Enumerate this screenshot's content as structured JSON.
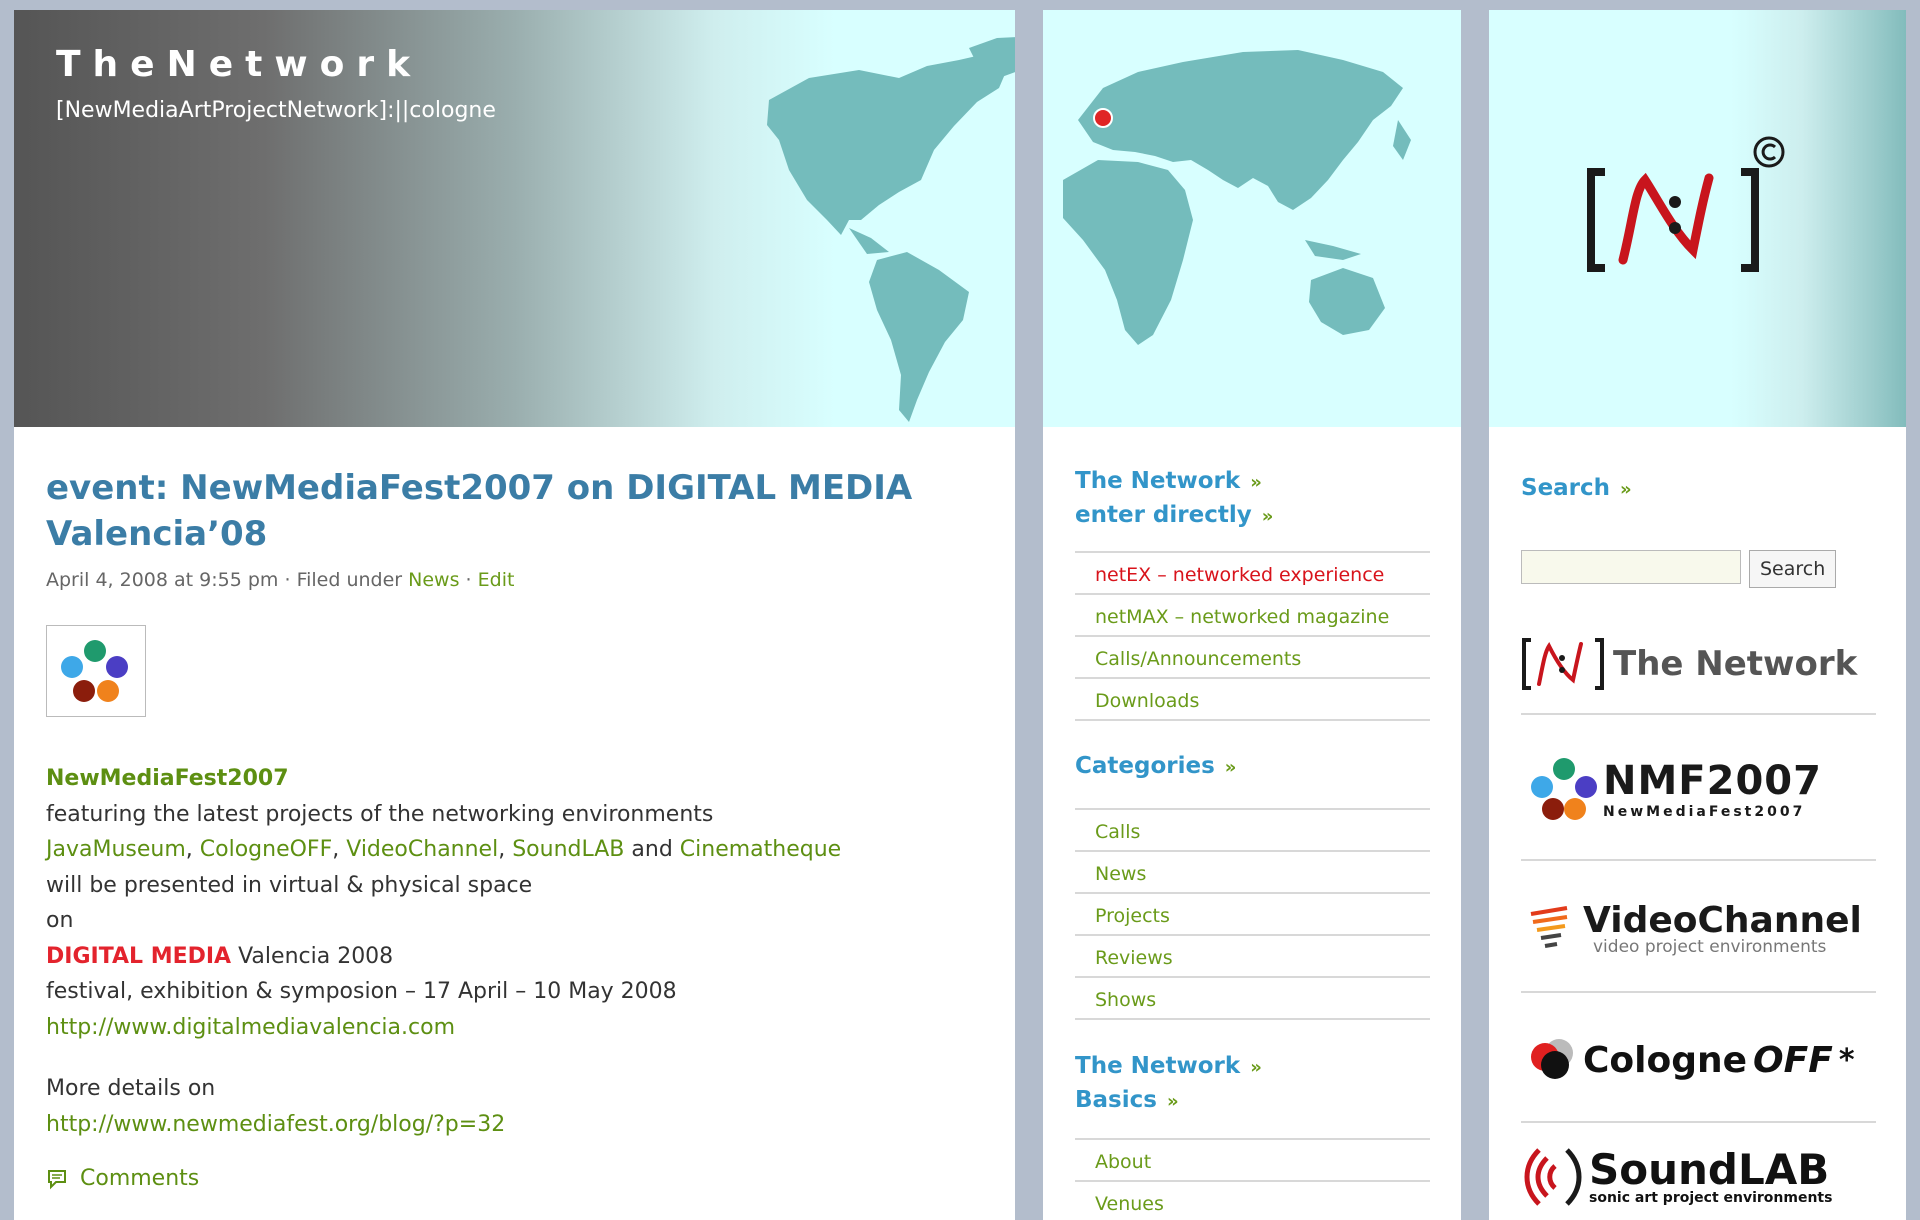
{
  "site": {
    "title": "TheNetwork",
    "tagline": "[NewMediaArtProjectNetwork]:||cologne"
  },
  "post": {
    "title": "event: NewMediaFest2007 on DIGITAL MEDIA Valencia’08",
    "date": "April 4, 2008 at 9:55 pm",
    "filed_under": "· Filed under",
    "category": "News",
    "sep": "·",
    "edit": "Edit",
    "fest_name": "NewMediaFest2007",
    "line1": "featuring the latest projects of the networking environments",
    "env_links": [
      "JavaMuseum",
      "CologneOFF",
      "VideoChannel",
      "SoundLAB",
      "Cinematheque"
    ],
    "and": "and",
    "line3": "will be presented in virtual & physical space",
    "line4": "on",
    "dm_red": "DIGITAL MEDIA",
    "dm_rest": "Valencia 2008",
    "line6": "festival, exhibition & symposion – 17 April – 10 May 2008",
    "url1": "http://www.digitalmediavalencia.com",
    "more": "More details on",
    "url2": "http://www.newmediafest.org/blog/?p=32",
    "comments": "Comments"
  },
  "sidebar_mid": {
    "head1": "The Network",
    "head2": "enter directly",
    "links": [
      "netEX – networked experience",
      "netMAX – networked magazine",
      "Calls/Announcements",
      "Downloads"
    ],
    "categories_head": "Categories",
    "categories": [
      "Calls",
      "News",
      "Projects",
      "Reviews",
      "Shows"
    ],
    "basics_head1": "The Network",
    "basics_head2": "Basics",
    "basics": [
      "About",
      "Venues"
    ],
    "raquo": "»"
  },
  "sidebar_right": {
    "search_head": "Search",
    "search_button": "Search",
    "search_value": "",
    "logos": {
      "network": "The Network",
      "nmf_big": "NMF2007",
      "nmf_small": "NewMediaFest2007",
      "vc_big": "VideoChannel",
      "vc_small": "video project environments",
      "cologne_a": "Cologne",
      "cologne_b": "OFF",
      "cologne_star": "*",
      "sound_big": "SoundLAB",
      "sound_small": "sonic art project environments"
    }
  },
  "colors": {
    "link_blue": "#3295c9",
    "title_blue": "#3b7da6",
    "link_green": "#6a9b1a",
    "active_red": "#d8131b",
    "map_teal": "#74bcbc",
    "header_cyan": "#d8ffff"
  }
}
